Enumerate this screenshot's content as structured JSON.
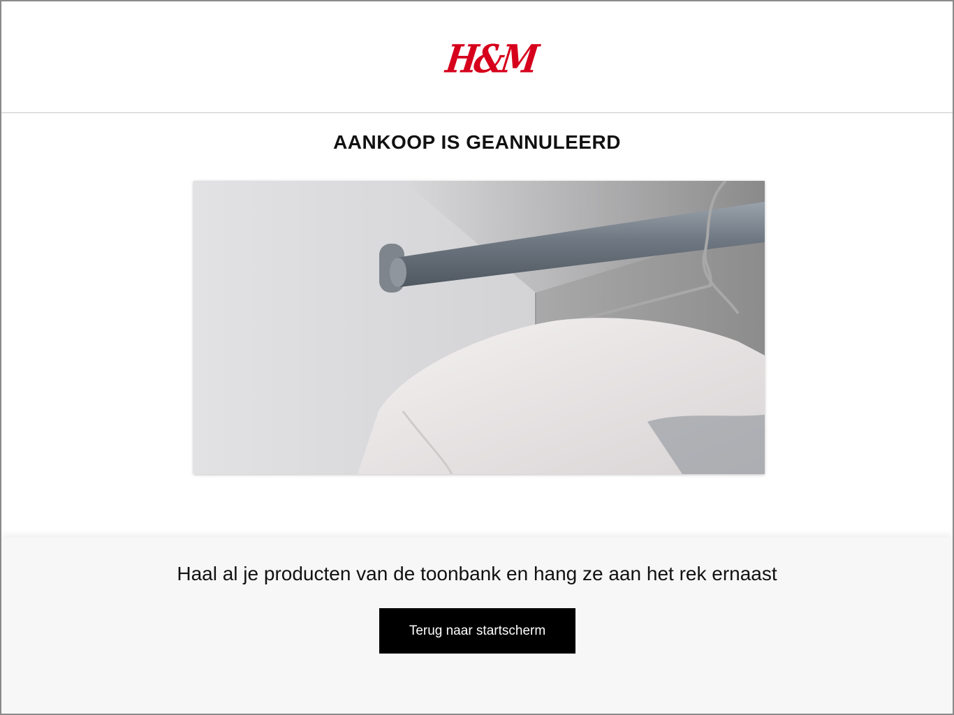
{
  "brand": {
    "logo_text": "H&M",
    "logo_color": "#d6001c"
  },
  "main": {
    "title": "AANKOOP IS GEANNULEERD",
    "image": {
      "subject": "clothes-rail-with-hanger-and-white-garment"
    }
  },
  "footer": {
    "instruction": "Haal al je producten van de toonbank en hang ze aan het rek ernaast",
    "back_button_label": "Terug naar startscherm",
    "back_button_color": "#000000",
    "background_color": "#f7f7f7"
  }
}
